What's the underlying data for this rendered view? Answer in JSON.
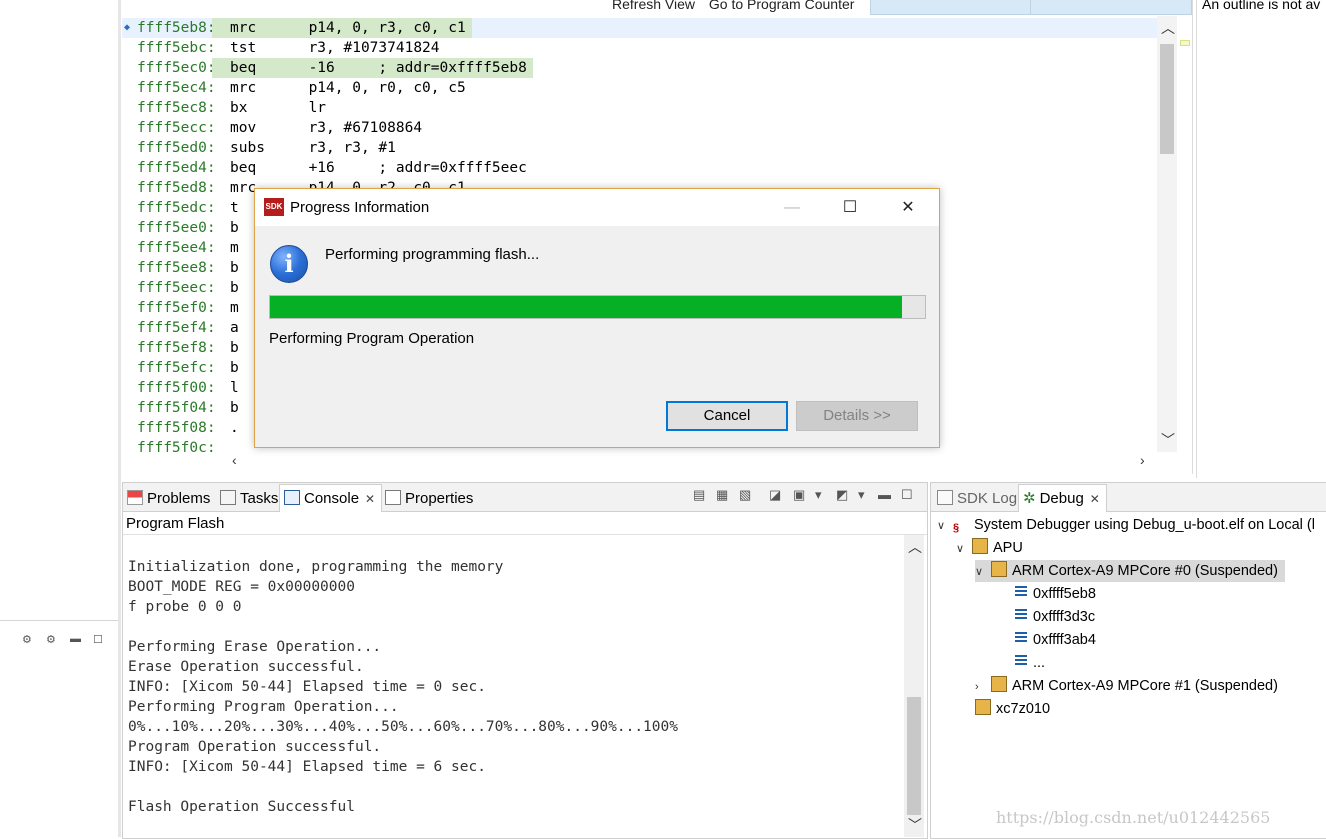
{
  "editor": {
    "toolbar": {
      "refresh_view": "Refresh View",
      "go_to_pc": "Go to Program Counter"
    },
    "lines": [
      {
        "addr": "ffff5eb8:",
        "instr": "mrc      p14, 0, r3, c0, c1",
        "highlight": true,
        "current": true
      },
      {
        "addr": "ffff5ebc:",
        "instr": "tst      r3, #1073741824",
        "highlight": false,
        "current": false
      },
      {
        "addr": "ffff5ec0:",
        "instr": "beq      -16     ; addr=0xffff5eb8",
        "highlight": true,
        "current": false
      },
      {
        "addr": "ffff5ec4:",
        "instr": "mrc      p14, 0, r0, c0, c5",
        "highlight": false,
        "current": false
      },
      {
        "addr": "ffff5ec8:",
        "instr": "bx       lr",
        "highlight": false,
        "current": false
      },
      {
        "addr": "ffff5ecc:",
        "instr": "mov      r3, #67108864",
        "highlight": false,
        "current": false
      },
      {
        "addr": "ffff5ed0:",
        "instr": "subs     r3, r3, #1",
        "highlight": false,
        "current": false
      },
      {
        "addr": "ffff5ed4:",
        "instr": "beq      +16     ; addr=0xffff5eec",
        "highlight": false,
        "current": false
      },
      {
        "addr": "ffff5ed8:",
        "instr": "mrc      p14, 0, r2, c0, c1",
        "highlight": false,
        "current": false
      },
      {
        "addr": "ffff5edc:",
        "instr": "t",
        "highlight": false,
        "current": false
      },
      {
        "addr": "ffff5ee0:",
        "instr": "b",
        "highlight": false,
        "current": false
      },
      {
        "addr": "ffff5ee4:",
        "instr": "m",
        "highlight": false,
        "current": false
      },
      {
        "addr": "ffff5ee8:",
        "instr": "b",
        "highlight": false,
        "current": false
      },
      {
        "addr": "ffff5eec:",
        "instr": "b",
        "highlight": false,
        "current": false
      },
      {
        "addr": "ffff5ef0:",
        "instr": "m",
        "highlight": false,
        "current": false
      },
      {
        "addr": "ffff5ef4:",
        "instr": "a",
        "highlight": false,
        "current": false
      },
      {
        "addr": "ffff5ef8:",
        "instr": "b",
        "highlight": false,
        "current": false
      },
      {
        "addr": "ffff5efc:",
        "instr": "b",
        "highlight": false,
        "current": false
      },
      {
        "addr": "ffff5f00:",
        "instr": "l",
        "highlight": false,
        "current": false
      },
      {
        "addr": "ffff5f04:",
        "instr": "b",
        "highlight": false,
        "current": false
      },
      {
        "addr": "ffff5f08:",
        "instr": ".",
        "highlight": false,
        "current": false
      },
      {
        "addr": "ffff5f0c:",
        "instr": "",
        "highlight": false,
        "current": false
      }
    ]
  },
  "outline": {
    "message": "An outline is not av"
  },
  "console_panel": {
    "tabs": {
      "problems": "Problems",
      "tasks": "Tasks",
      "console": "Console",
      "properties": "Properties"
    },
    "title": "Program Flash",
    "output": "Initialization done, programming the memory\nBOOT_MODE REG = 0x00000000\nf probe 0 0 0\n\nPerforming Erase Operation...\nErase Operation successful.\nINFO: [Xicom 50-44] Elapsed time = 0 sec.\nPerforming Program Operation...\n0%...10%...20%...30%...40%...50%...60%...70%...80%...90%...100%\nProgram Operation successful.\nINFO: [Xicom 50-44] Elapsed time = 6 sec.\n\nFlash Operation Successful"
  },
  "debug_panel": {
    "tabs": {
      "sdk_log": "SDK Log",
      "debug": "Debug"
    },
    "tree": {
      "launch": "System Debugger using Debug_u-boot.elf on Local (l",
      "apu": "APU",
      "core0": "ARM Cortex-A9 MPCore #0 (Suspended)",
      "frames": [
        "0xffff5eb8",
        "0xffff3d3c",
        "0xffff3ab4",
        "..."
      ],
      "core1": "ARM Cortex-A9 MPCore #1 (Suspended)",
      "device": "xc7z010"
    }
  },
  "dialog": {
    "app_icon_text": "SDK",
    "title": "Progress Information",
    "message": "Performing programming flash...",
    "progress": 0.965,
    "progress_color": "#06b025",
    "subtask": "Performing Program Operation",
    "cancel_label": "Cancel",
    "details_label": "Details >>",
    "icon": "info-icon"
  },
  "watermark": "https://blog.csdn.net/u012442565"
}
